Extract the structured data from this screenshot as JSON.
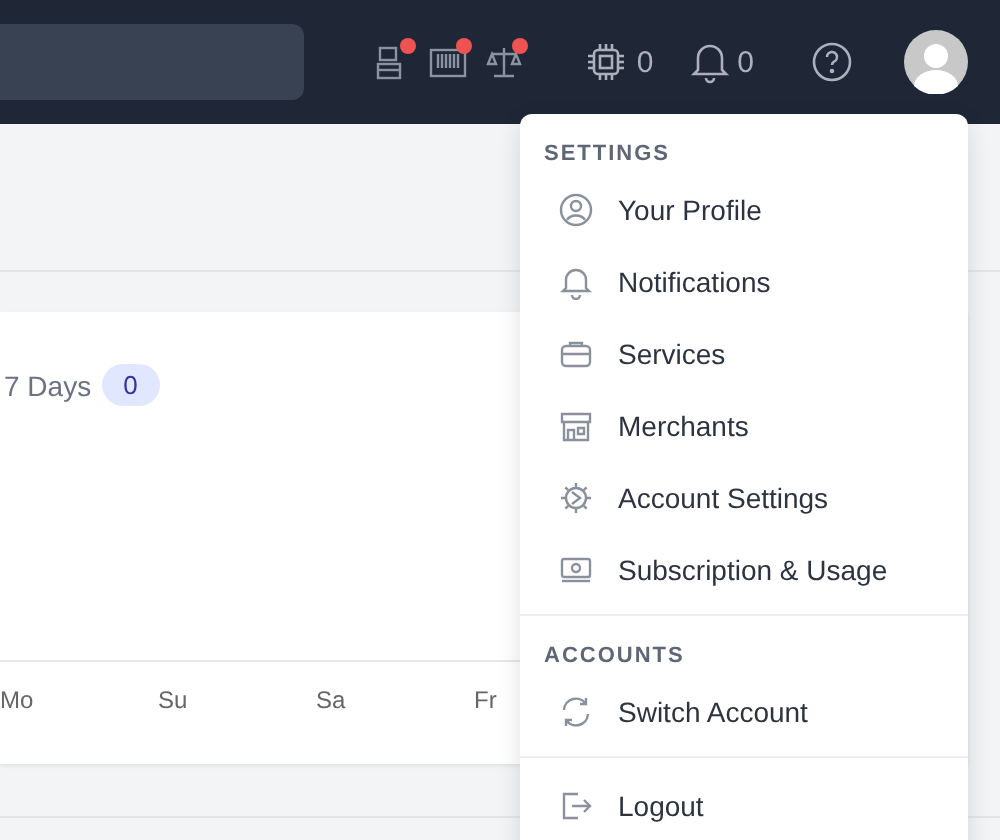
{
  "header": {
    "alerts": [
      {
        "kind": "register",
        "dot": true
      },
      {
        "kind": "barcode",
        "dot": true
      },
      {
        "kind": "scale",
        "dot": true
      }
    ],
    "chip_count": "0",
    "notification_count": "0"
  },
  "chart_card": {
    "title": "7 Days",
    "badge": "0",
    "x_labels": [
      "Mo",
      "Su",
      "Sa",
      "Fr"
    ]
  },
  "menu": {
    "sections": [
      {
        "title": "SETTINGS",
        "items": [
          {
            "kind": "profile",
            "label": "Your Profile"
          },
          {
            "kind": "bell",
            "label": "Notifications"
          },
          {
            "kind": "briefcase",
            "label": "Services"
          },
          {
            "kind": "store",
            "label": "Merchants"
          },
          {
            "kind": "gear",
            "label": "Account Settings"
          },
          {
            "kind": "money",
            "label": "Subscription & Usage"
          }
        ]
      },
      {
        "title": "ACCOUNTS",
        "items": [
          {
            "kind": "switch",
            "label": "Switch Account"
          }
        ]
      },
      {
        "items": [
          {
            "kind": "logout",
            "label": "Logout"
          }
        ]
      }
    ]
  }
}
